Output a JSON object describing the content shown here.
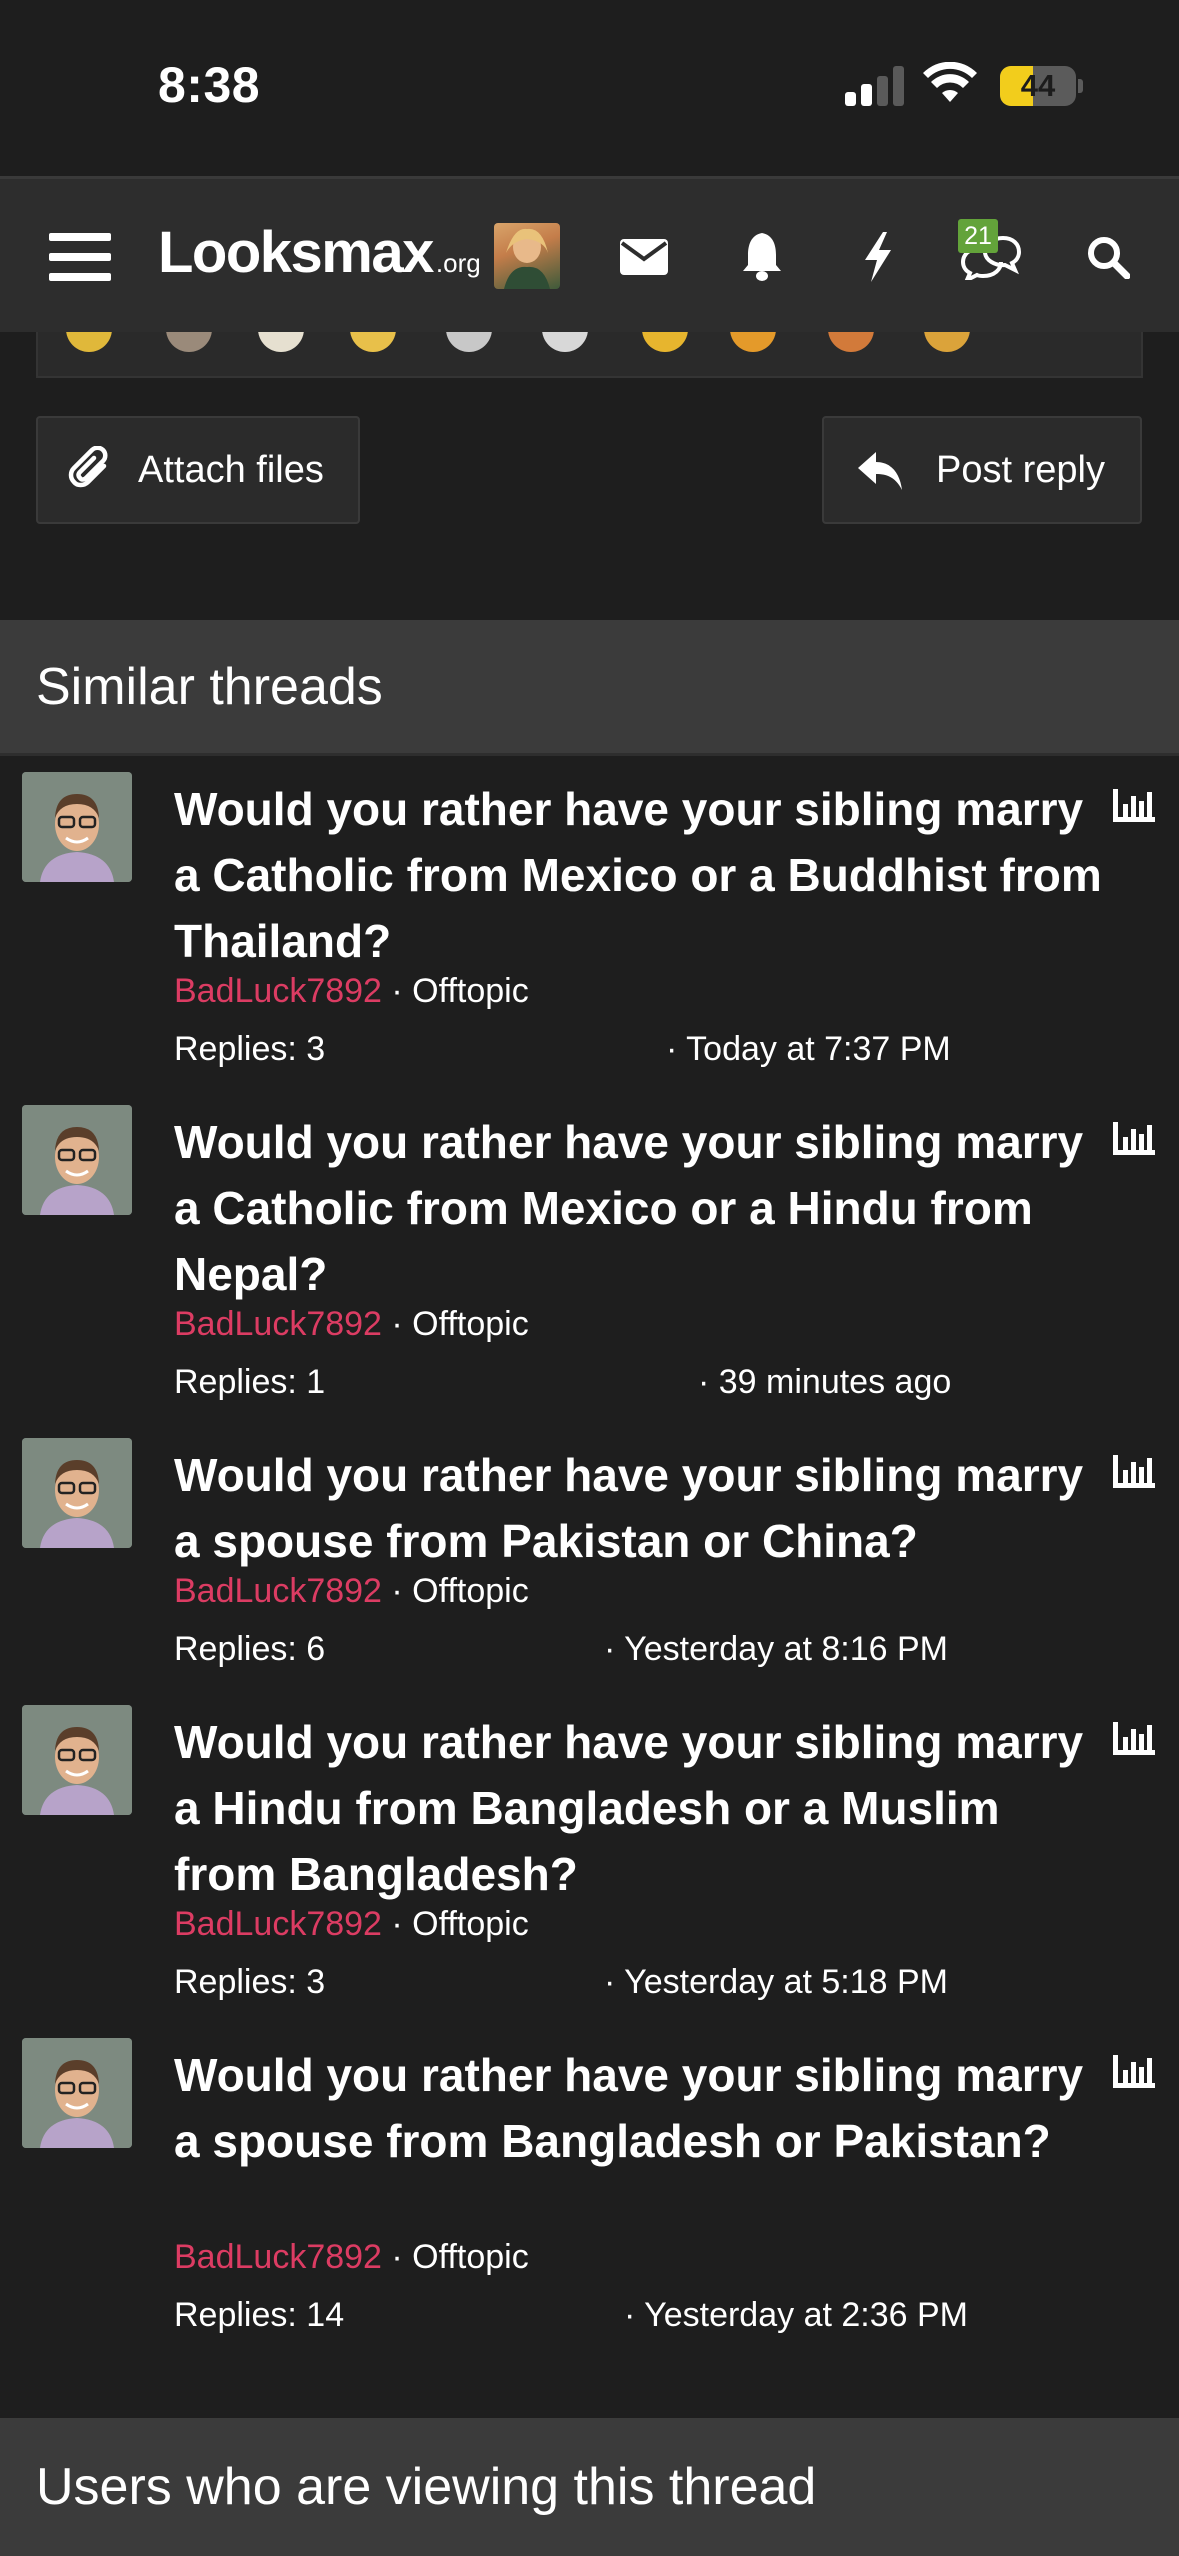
{
  "status_bar": {
    "time": "8:38",
    "battery": "44",
    "battery_level": 0.44
  },
  "nav": {
    "logo_main": "Looksmax",
    "logo_tld": ".org",
    "conversations_badge": "21"
  },
  "actions": {
    "attach_label": "Attach files",
    "reply_label": "Post reply"
  },
  "similar": {
    "heading": "Similar threads",
    "threads": [
      {
        "title": "Would you rather have your sibling marry a Catholic from Mexico or a Buddhist from Thailand?",
        "author": "BadLuck7892",
        "forum": "· Offtopic",
        "replies": "Replies: 3",
        "date": "· Today at 7:37 PM"
      },
      {
        "title": "Would you rather have your sibling marry a Catholic from Mexico or a Hindu from Nepal?",
        "author": "BadLuck7892",
        "forum": "· Offtopic",
        "replies": "Replies: 1",
        "date": "· 39 minutes ago"
      },
      {
        "title": "Would you rather have your sibling marry a spouse from Pakistan or China?",
        "author": "BadLuck7892",
        "forum": "· Offtopic",
        "replies": "Replies: 6",
        "date": "· Yesterday at 8:16 PM"
      },
      {
        "title": "Would you rather have your sibling marry a Hindu from Bangladesh or a Muslim from Bangladesh?",
        "author": "BadLuck7892",
        "forum": "· Offtopic",
        "replies": "Replies: 3",
        "date": "· Yesterday at 5:18 PM"
      },
      {
        "title": "Would you rather have your sibling marry a spouse from Bangladesh or Pakistan?",
        "author": "BadLuck7892",
        "forum": "· Offtopic",
        "replies": "Replies: 14",
        "date": "· Yesterday at 2:36 PM"
      }
    ]
  },
  "viewers": {
    "heading": "Users who are viewing this thread"
  }
}
